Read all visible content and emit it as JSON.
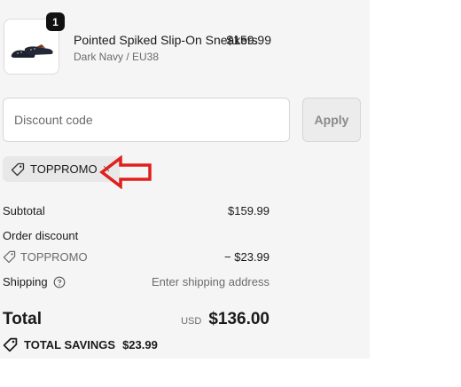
{
  "product": {
    "name": "Pointed Spiked Slip-On Sneakers",
    "variant": "Dark Navy / EU38",
    "price": "$159.99",
    "quantity": "1"
  },
  "discount": {
    "placeholder": "Discount code",
    "apply_label": "Apply",
    "applied_code": "TOPPROMO"
  },
  "summary": {
    "subtotal_label": "Subtotal",
    "subtotal_value": "$159.99",
    "order_discount_label": "Order discount",
    "discount_code": "TOPPROMO",
    "discount_value": "− $23.99",
    "shipping_label": "Shipping",
    "shipping_value": "Enter shipping address",
    "total_label": "Total",
    "currency": "USD",
    "total_value": "$136.00",
    "savings_label": "TOTAL SAVINGS",
    "savings_value": "$23.99"
  },
  "colors": {
    "panel_bg": "#f5f5f5",
    "arrow": "#e0201c",
    "badge": "#111111"
  },
  "icons": [
    "tag-icon",
    "close-icon",
    "help-circle-icon",
    "shoe-image",
    "red-arrow-annotation"
  ]
}
